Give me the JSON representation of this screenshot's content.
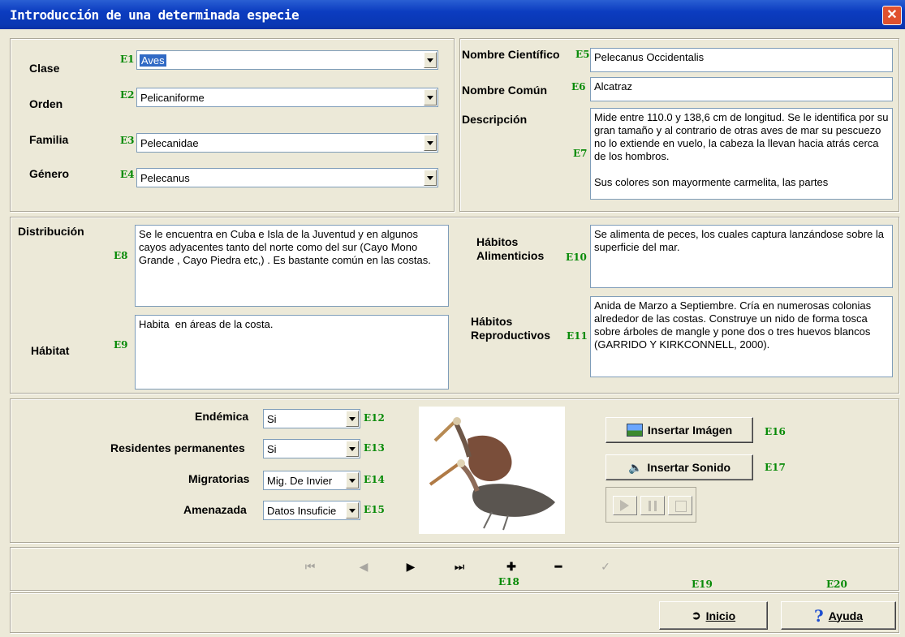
{
  "window": {
    "title": "Introducción de una determinada especie",
    "close_glyph": "✕"
  },
  "taxonomy": {
    "clase": {
      "label": "Clase",
      "code": "E1",
      "value": "Aves"
    },
    "orden": {
      "label": "Orden",
      "code": "E2",
      "value": "Pelicaniforme"
    },
    "familia": {
      "label": "Familia",
      "code": "E3",
      "value": "Pelecanidae"
    },
    "genero": {
      "label": "Género",
      "code": "E4",
      "value": "Pelecanus"
    }
  },
  "names": {
    "cientifico": {
      "label": "Nombre Científico",
      "code": "E5",
      "value": "Pelecanus Occidentalis"
    },
    "comun": {
      "label": "Nombre Común",
      "code": "E6",
      "value": "Alcatraz"
    },
    "descripcion": {
      "label": "Descripción",
      "code": "E7",
      "value": "Mide entre 110.0 y 138,6 cm de longitud. Se le identifica por su gran tamaño y al contrario de otras aves de mar su pescuezo no lo extiende en vuelo, la cabeza la llevan hacia atrás cerca de los hombros.\n\nSus colores son mayormente carmelita, las partes"
    }
  },
  "ecology": {
    "distribucion": {
      "label": "Distribución",
      "code": "E8",
      "value": "Se le encuentra en Cuba e Isla de la Juventud y en algunos cayos adyacentes tanto del norte como del sur (Cayo Mono Grande , Cayo Piedra etc,) . Es bastante común en las costas."
    },
    "habitat": {
      "label": "Hábitat",
      "code": "E9",
      "value": "Habita  en áreas de la costa."
    },
    "alimenticios": {
      "label_1": "Hábitos",
      "label_2": "Alimenticios",
      "code": "E10",
      "value": "Se alimenta de peces, los cuales captura lanzándose sobre la superficie del mar."
    },
    "reproductivos": {
      "label_1": "Hábitos",
      "label_2": "Reproductivos",
      "code": "E11",
      "value": "Anida de Marzo a Septiembre. Cría en numerosas colonias alrededor de las costas. Construye un nido de forma tosca sobre árboles de mangle y pone dos o tres huevos blancos (GARRIDO Y KIRKCONNELL, 2000)."
    }
  },
  "status": {
    "endemica": {
      "label": "Endémica",
      "code": "E12",
      "value": "Si"
    },
    "residentes": {
      "label": "Residentes permanentes",
      "code": "E13",
      "value": "Si"
    },
    "migratorias": {
      "label": "Migratorias",
      "code": "E14",
      "value": "Mig. De Invier"
    },
    "amenazada": {
      "label": "Amenazada",
      "code": "E15",
      "value": "Datos Insuficie"
    }
  },
  "media": {
    "insert_image": {
      "label": "Insertar Imágen",
      "code": "E16"
    },
    "insert_sound": {
      "label": "Insertar Sonido",
      "code": "E17"
    }
  },
  "navigator": {
    "code": "E18",
    "plus": "✚",
    "minus": "━",
    "check": "✓"
  },
  "footer": {
    "inicio": {
      "label": "Inicio",
      "code": "E19"
    },
    "ayuda": {
      "label": "Ayuda",
      "code": "E20"
    }
  },
  "colors": {
    "titlebar": "#0a37b3",
    "code_green": "#078a07",
    "face": "#ece9d8"
  }
}
